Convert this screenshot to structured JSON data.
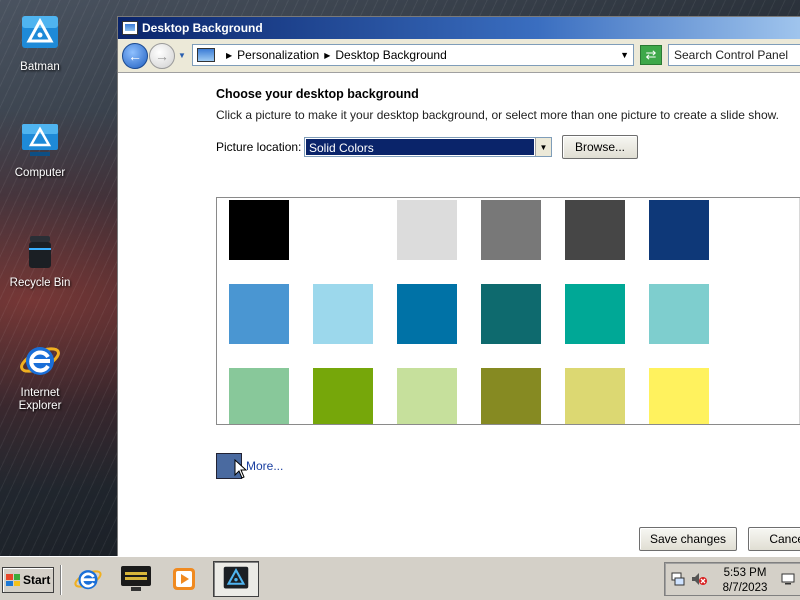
{
  "desktop": {
    "icons": [
      {
        "label": "Batman",
        "icon": "triangle-app-icon"
      },
      {
        "label": "Computer",
        "icon": "computer-icon"
      },
      {
        "label": "Recycle Bin",
        "icon": "recycle-bin-icon"
      },
      {
        "label": "Internet Explorer",
        "icon": "internet-explorer-icon"
      }
    ]
  },
  "window": {
    "title": "Desktop Background",
    "address": {
      "crumbs": [
        "Personalization",
        "Desktop Background"
      ]
    },
    "search_placeholder": "Search Control Panel"
  },
  "content": {
    "heading": "Choose your desktop background",
    "description": "Click a picture to make it your desktop background, or select more than one picture to create a slide show.",
    "picture_location_label": "Picture location:",
    "picture_location_value": "Solid Colors",
    "browse_label": "Browse...",
    "swatches": [
      "#000000",
      "#ffffff",
      "#dcdcdc",
      "#787878",
      "#464646",
      "#0e3878",
      "#4a96d2",
      "#9cd8ec",
      "#0072a6",
      "#0e6a6e",
      "#00a896",
      "#7ecece",
      "#88c89a",
      "#76a70a",
      "#c6e09c",
      "#868a22",
      "#dcd872",
      "#fff25e"
    ],
    "more_label": "More...",
    "more_color": "#4a6aa0",
    "save_label": "Save changes",
    "cancel_label": "Cancel"
  },
  "taskbar": {
    "start_label": "Start",
    "apps": [
      "internet-explorer-icon",
      "monitor-icon",
      "media-player-icon",
      "triangle-app-icon"
    ],
    "time": "5:53 PM",
    "date": "8/7/2023"
  }
}
